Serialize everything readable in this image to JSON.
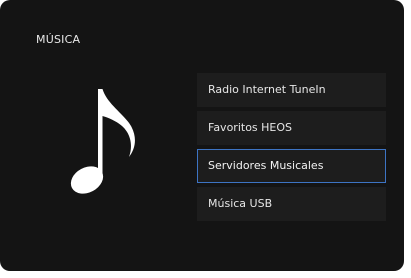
{
  "screen": {
    "title": "MÚSICA",
    "icon": "music-note-icon"
  },
  "colors": {
    "background": "#141414",
    "menu_item": "#1d1d1d",
    "selection_border": "#3d74c4",
    "text": "#e6e6e6"
  },
  "menu": {
    "selected_index": 2,
    "items": [
      {
        "label": "Radio Internet TuneIn"
      },
      {
        "label": "Favoritos HEOS"
      },
      {
        "label": "Servidores Musicales"
      },
      {
        "label": "Música USB"
      }
    ]
  }
}
